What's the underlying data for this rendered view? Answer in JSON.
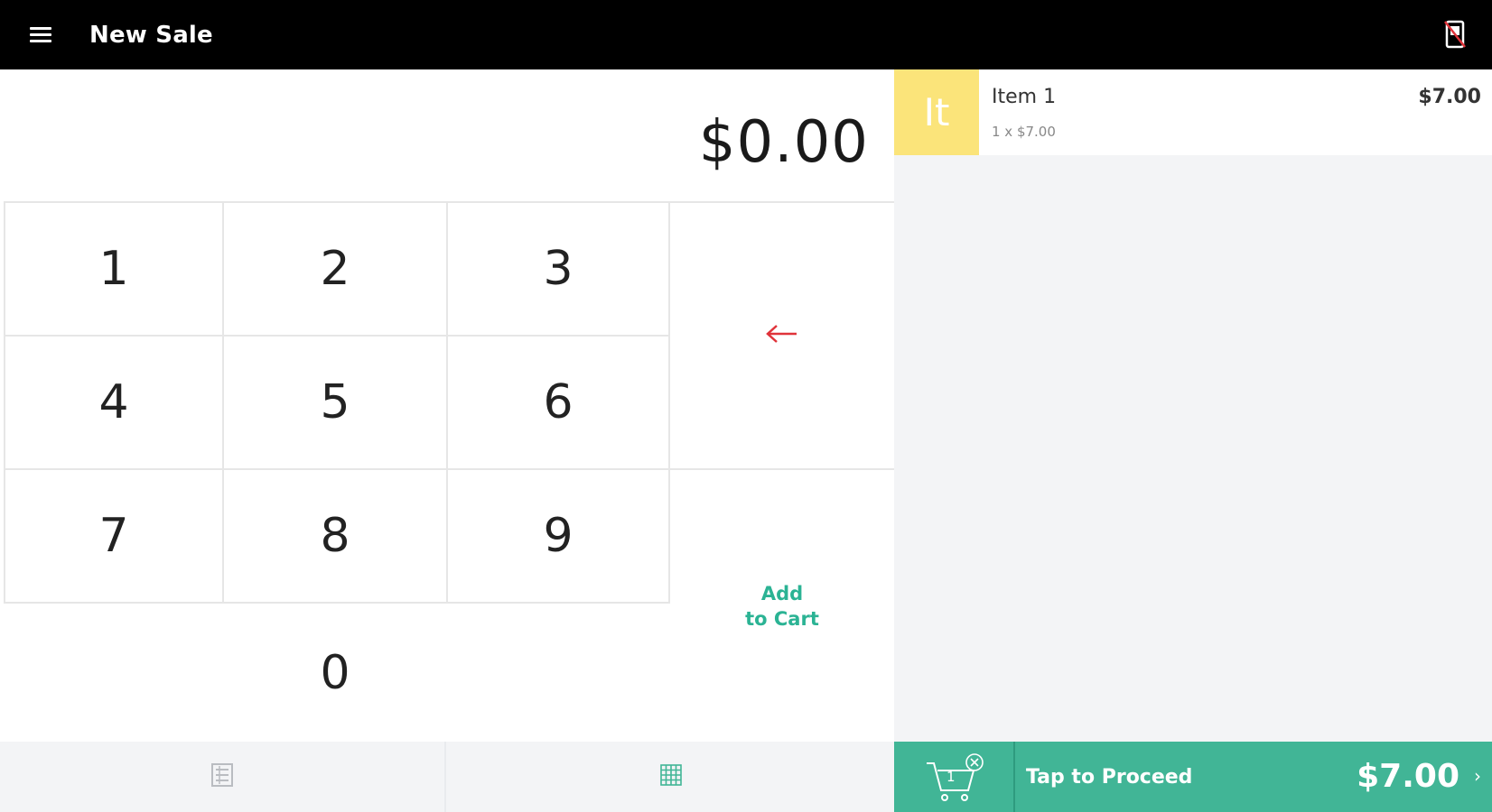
{
  "header": {
    "title": "New Sale",
    "menu_icon": "hamburger-menu-icon",
    "device_icon": "card-reader-disconnected-icon"
  },
  "keypad": {
    "amount": "$0.00",
    "keys": [
      "1",
      "2",
      "3",
      "4",
      "5",
      "6",
      "7",
      "8",
      "9",
      "0"
    ],
    "backspace_icon": "backspace-arrow-icon",
    "add_to_cart_line1": "Add",
    "add_to_cart_line2": "to Cart"
  },
  "bottom_tabs": {
    "list_icon": "library-list-icon",
    "grid_icon": "keypad-grid-icon"
  },
  "cart": {
    "items": [
      {
        "thumb_text": "It",
        "name": "Item 1",
        "quantity_line": "1 x $7.00",
        "price": "$7.00"
      }
    ]
  },
  "checkout": {
    "cart_count": "1",
    "cart_icon": "shopping-cart-icon",
    "clear_icon": "clear-cart-icon",
    "proceed_label": "Tap to Proceed",
    "total": "$7.00",
    "chevron": "›"
  },
  "colors": {
    "accent": "#41b596",
    "add_to_cart_text": "#2bb394",
    "backspace": "#e0333a",
    "item_thumb": "#fbe47a",
    "header_bg": "#000000"
  }
}
